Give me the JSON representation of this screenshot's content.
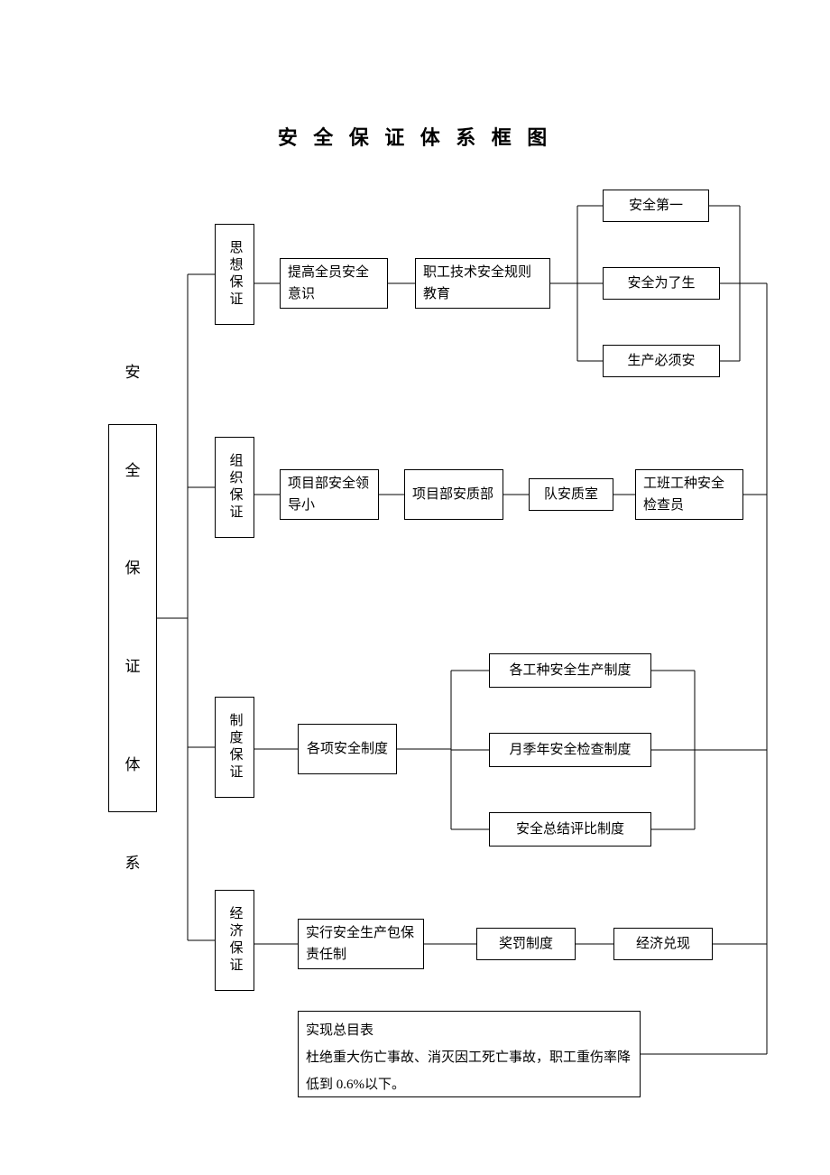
{
  "title": "安 全 保 证 体 系 框 图",
  "root": "安\n\n全\n\n保\n\n证\n\n体\n\n系",
  "branch1": {
    "label": "思想保证",
    "n1": "提高全员安全意识",
    "n2": "职工技术安全规则教育",
    "leaves": [
      "安全第一",
      "安全为了生",
      "生产必须安"
    ]
  },
  "branch2": {
    "label": "组织保证",
    "n1": "项目部安全领导小",
    "n2": "项目部安质部",
    "n3": "队安质室",
    "n4": "工班工种安全检查员"
  },
  "branch3": {
    "label": "制度保证",
    "n1": "各项安全制度",
    "leaves": [
      "各工种安全生产制度",
      "月季年安全检查制度",
      "安全总结评比制度"
    ]
  },
  "branch4": {
    "label": "经济保证",
    "n1": "实行安全生产包保责任制",
    "n2": "奖罚制度",
    "n3": "经济兑现"
  },
  "goal": "实现总目表\n杜绝重大伤亡事故、消灭因工死亡事故，职工重伤率降低到 0.6%以下。"
}
